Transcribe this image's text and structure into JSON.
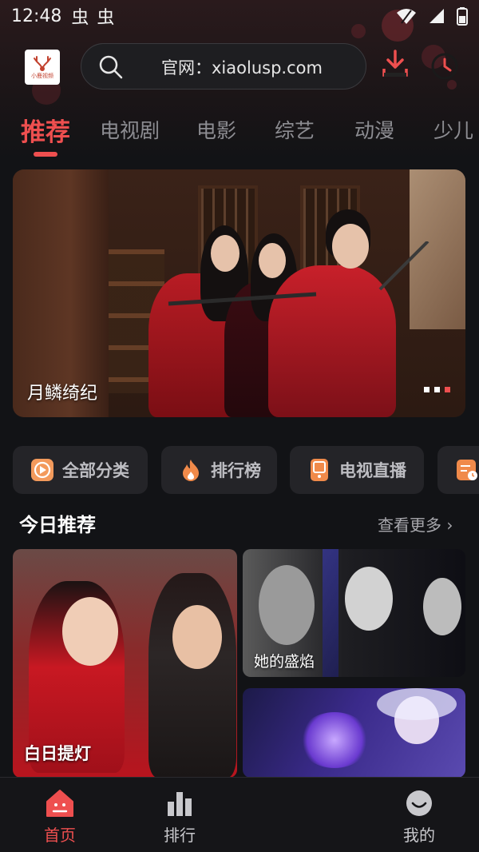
{
  "status_bar": {
    "time": "12:48",
    "notif_glyphs": [
      "虫",
      "虫"
    ]
  },
  "header": {
    "logo_text": "小鹿视频",
    "search_text": "官网：xiaolusp.com",
    "download_icon": "download-icon",
    "history_icon": "history-clock-icon"
  },
  "tabs": [
    "推荐",
    "电视剧",
    "电影",
    "综艺",
    "动漫",
    "少儿"
  ],
  "active_tab": 0,
  "banner": {
    "title": "月鳞绮纪",
    "page_count": 3,
    "active_page": 2
  },
  "quick_links": [
    {
      "label": "全部分类",
      "icon": "play-category-icon"
    },
    {
      "label": "排行榜",
      "icon": "flame-icon"
    },
    {
      "label": "电视直播",
      "icon": "tv-icon"
    },
    {
      "label": "",
      "icon": "history-list-icon"
    }
  ],
  "section": {
    "title": "今日推荐",
    "more": "查看更多 ›"
  },
  "cards": [
    {
      "title": "白日提灯"
    },
    {
      "title": "她的盛焰"
    },
    {
      "title": ""
    }
  ],
  "bottom_nav": [
    {
      "label": "首页",
      "icon": "home-icon"
    },
    {
      "label": "排行",
      "icon": "bar-chart-icon"
    },
    {
      "label": "我的",
      "icon": "smile-face-icon"
    }
  ],
  "colors": {
    "accent": "#ee4f4f",
    "background": "#121316"
  }
}
